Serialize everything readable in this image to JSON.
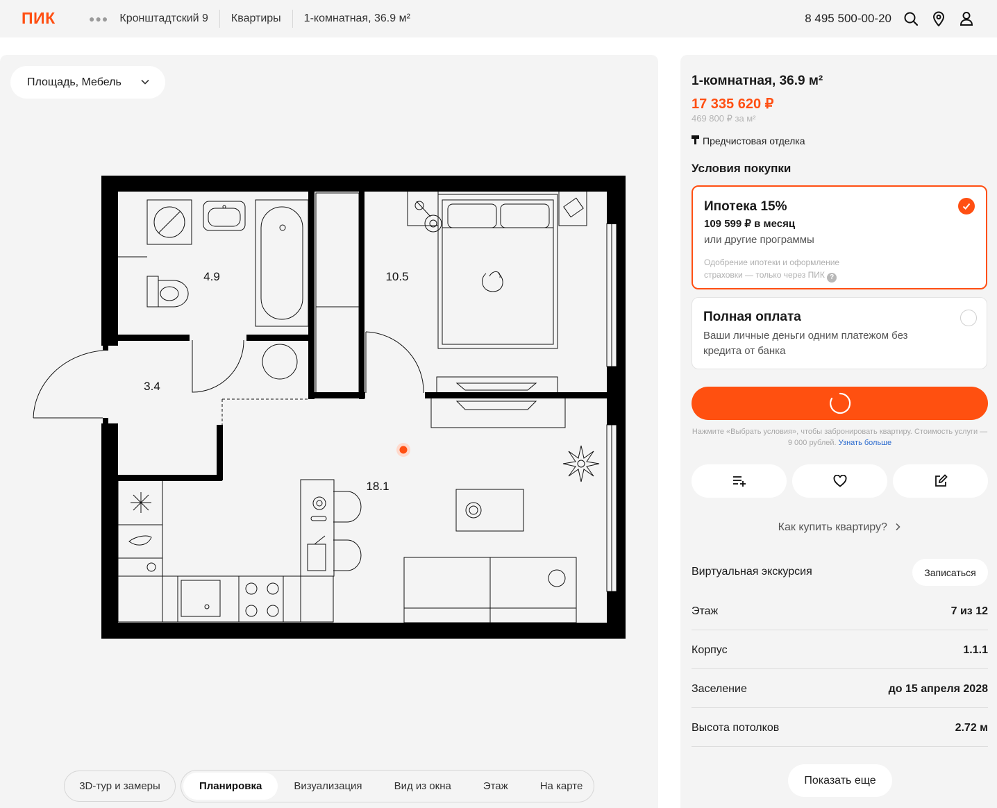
{
  "header": {
    "logo": "ПИК",
    "breadcrumbs": [
      "Кронштадтский 9",
      "Квартиры",
      "1-комнатная, 36.9 м²"
    ],
    "phone": "8 495 500-00-20"
  },
  "plan": {
    "view_select": "Площадь, Мебель",
    "rooms": [
      {
        "label": "4.9"
      },
      {
        "label": "10.5"
      },
      {
        "label": "3.4"
      },
      {
        "label": "18.1"
      }
    ],
    "tour_tab": "3D-тур и замеры",
    "tabs": [
      "Планировка",
      "Визуализация",
      "Вид из окна",
      "Этаж",
      "На карте"
    ],
    "active_tab": "Планировка"
  },
  "info": {
    "title": "1-комнатная, 36.9 м²",
    "price": "17 335 620 ₽",
    "price_per_m2": "469 800 ₽ за м²",
    "finish": "Предчистовая отделка",
    "conditions_title": "Условия покупки",
    "mortgage": {
      "title": "Ипотека 15%",
      "monthly": "109 599 ₽ в месяц",
      "other": "или другие программы",
      "note": "Одобрение ипотеки и оформление страховки — только через ПИК",
      "selected": true
    },
    "full_payment": {
      "title": "Полная оплата",
      "desc": "Ваши личные деньги одним платежом без кредита от банка",
      "selected": false
    },
    "booking_note": "Нажмите «Выбрать условия», чтобы забронировать квартиру. Стоимость услуги — 9 000 рублей.",
    "booking_link": "Узнать больше",
    "how_to_buy": "Как купить квартиру?",
    "virtual_tour": "Виртуальная экскурсия",
    "signup": "Записаться",
    "properties": [
      {
        "key": "Этаж",
        "value": "7 из 12"
      },
      {
        "key": "Корпус",
        "value": "1.1.1"
      },
      {
        "key": "Заселение",
        "value": "до 15 апреля 2028"
      },
      {
        "key": "Высота потолков",
        "value": "2.72 м"
      }
    ],
    "show_more": "Показать еще"
  },
  "colors": {
    "accent": "#ff4f12",
    "panel": "#f4f4f4",
    "link": "#2d6ccf"
  }
}
